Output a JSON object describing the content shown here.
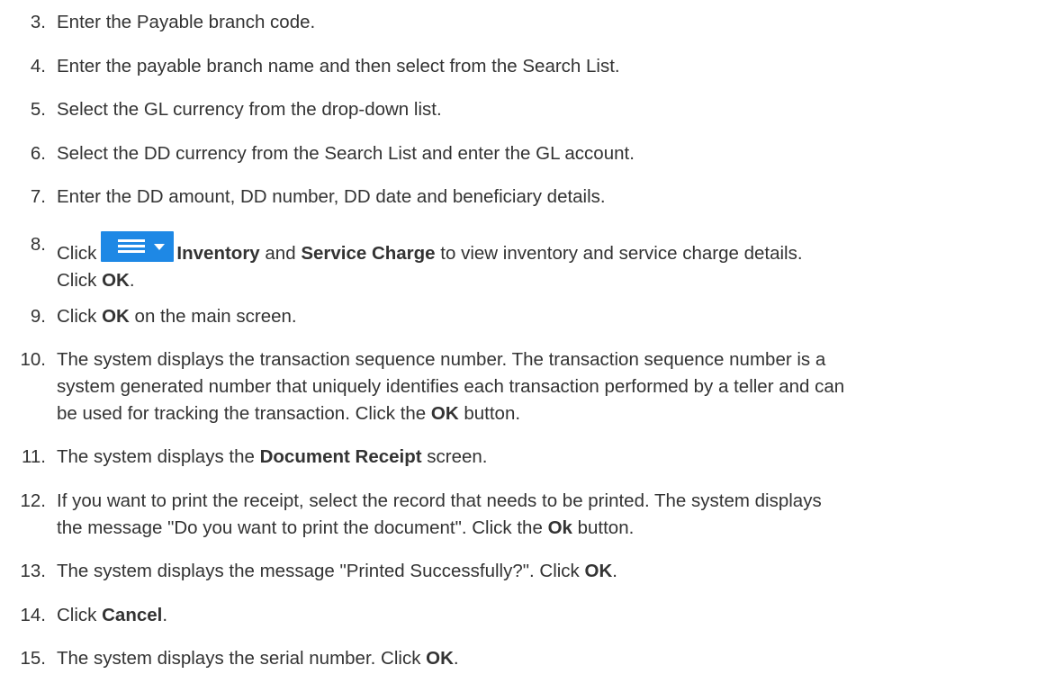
{
  "steps": [
    {
      "num": "3.",
      "text": "Enter the Payable branch code."
    },
    {
      "num": "4.",
      "text": "Enter the payable branch name and then select from the Search List."
    },
    {
      "num": "5.",
      "text": "Select the GL currency from the drop-down list."
    },
    {
      "num": "6.",
      "text": "Select the DD currency from the Search List and enter the GL account."
    },
    {
      "num": "7.",
      "text": "Enter the DD amount, DD number, DD date and beneficiary details."
    },
    {
      "num": "8.",
      "click": "Click",
      "inventory": "Inventory",
      "and": " and ",
      "service_charge": "Service Charge",
      "rest": " to view inventory and service charge details.",
      "line2_click": "Click ",
      "line2_ok": "OK",
      "line2_end": ".",
      "menu_icon": "hamburger-dropdown-icon",
      "menu_color": "#1e88e5"
    },
    {
      "num": "9.",
      "pre": "Click ",
      "bold": "OK",
      "post": " on the main screen."
    },
    {
      "num": "10.",
      "line1": "The system displays the transaction sequence number. The transaction sequence number is a",
      "line2": "system generated number that uniquely identifies each transaction performed by a teller and can",
      "line3_pre": "be used for tracking the transaction. Click the ",
      "line3_bold": "OK",
      "line3_post": " button."
    },
    {
      "num": "11.",
      "pre": "The system displays the ",
      "bold": "Document Receipt",
      "post": " screen."
    },
    {
      "num": "12.",
      "line1": "If you want to print the receipt, select the record that needs to be printed. The system displays",
      "line2_pre": "the message \"Do you want to print the document\". Click the ",
      "line2_bold": "Ok",
      "line2_post": " button."
    },
    {
      "num": "13.",
      "pre": "The system displays the message \"Printed Successfully?\". Click ",
      "bold": "OK",
      "post": "."
    },
    {
      "num": "14.",
      "pre": "Click ",
      "bold": "Cancel",
      "post": "."
    },
    {
      "num": "15.",
      "pre": "The system displays the serial number. Click ",
      "bold": "OK",
      "post": "."
    }
  ]
}
